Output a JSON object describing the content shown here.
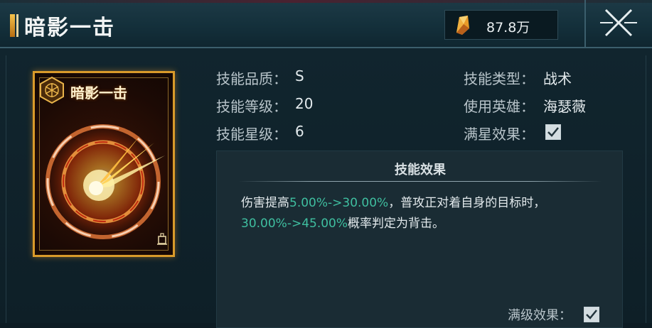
{
  "header": {
    "title": "暗影一击",
    "currency_value": "87.8万",
    "currency_icon": "crystal-icon",
    "close_icon": "close-icon"
  },
  "card": {
    "name": "暗影一击",
    "emblem_icon": "emblem-icon",
    "art_icon": "shadow-strike-art",
    "lock_icon": "bell-icon",
    "border_color": "#d99a2a"
  },
  "stats": {
    "quality_label": "技能品质：",
    "quality_value": "S",
    "level_label": "技能等级：",
    "level_value": "20",
    "star_label": "技能星级：",
    "star_value": "6",
    "type_label": "技能类型：",
    "type_value": "战术",
    "hero_label": "使用英雄：",
    "hero_value": "海瑟薇",
    "max_star_label": "满星效果：",
    "max_star_checked": true
  },
  "effect": {
    "title": "技能效果",
    "line1_a": "伤害提高",
    "line1_hl": "5.00%->30.00%",
    "line1_b": "，普攻正对着自身的目标时，",
    "line2_hl": "30.00%->45.00%",
    "line2_b": "概率判定为背击。",
    "max_level_label": "满级效果：",
    "max_level_checked": true,
    "highlight_color": "#3fbfa0"
  }
}
